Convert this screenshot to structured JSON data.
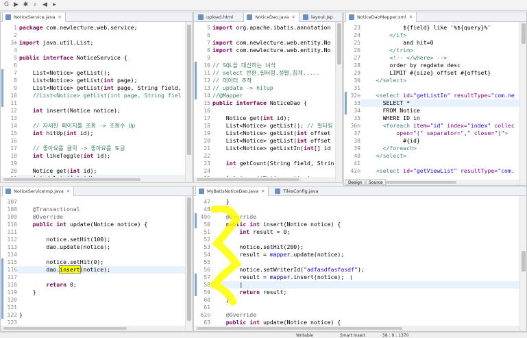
{
  "toolbar": {
    "icons": [
      "g-icon",
      "run-icon",
      "debug-icon",
      "search-icon",
      "nav-back-icon",
      "nav-forward-icon"
    ]
  },
  "pane_service": {
    "tabs": [
      {
        "label": "NoticeService.java",
        "close": "✕"
      }
    ],
    "lines": [
      {
        "n": "1",
        "t": [
          [
            "kw",
            "package "
          ],
          [
            "",
            "com.newlecture.web.service;"
          ]
        ]
      },
      {
        "n": "2",
        "t": []
      },
      {
        "n": "3⊕",
        "t": [
          [
            "kw",
            "import "
          ],
          [
            "",
            "java.util.List;"
          ]
        ]
      },
      {
        "n": "4",
        "t": []
      },
      {
        "n": "5",
        "t": [
          [
            "kw",
            "public interface "
          ],
          [
            "",
            "NoticeService {"
          ]
        ]
      },
      {
        "n": "6",
        "t": []
      },
      {
        "n": "7",
        "t": [
          [
            "",
            "    List<Notice> getList();"
          ]
        ]
      },
      {
        "n": "8",
        "t": [
          [
            "",
            "    List<Notice> getList("
          ],
          [
            "kw",
            "int "
          ],
          [
            "",
            "page);"
          ]
        ]
      },
      {
        "n": "9",
        "t": [
          [
            "",
            "    List<Notice> getList("
          ],
          [
            "kw",
            "int "
          ],
          [
            "",
            "page, String field,"
          ]
        ]
      },
      {
        "n": "10",
        "t": [
          [
            "cm",
            "    //List<Notice> getList(int page, String fiel"
          ]
        ]
      },
      {
        "n": "11",
        "t": []
      },
      {
        "n": "12",
        "t": [
          [
            "kw",
            "    int "
          ],
          [
            "",
            "insert(Notice notice);"
          ]
        ]
      },
      {
        "n": "13",
        "t": []
      },
      {
        "n": "14",
        "t": [
          [
            "cm",
            "    // 자세한 페이지를 조회 -> 조회수 Up"
          ]
        ]
      },
      {
        "n": "15",
        "t": [
          [
            "kw",
            "    int "
          ],
          [
            "",
            "hitUp("
          ],
          [
            "kw",
            "int "
          ],
          [
            "",
            "id);"
          ]
        ]
      },
      {
        "n": "16",
        "t": []
      },
      {
        "n": "17",
        "t": [
          [
            "cm",
            "    // 좋아요를 클릭 -> 좋아요를 토글"
          ]
        ]
      },
      {
        "n": "18",
        "t": [
          [
            "kw",
            "    int "
          ],
          [
            "",
            "likeToggle("
          ],
          [
            "kw",
            "int "
          ],
          [
            "",
            "id);"
          ]
        ]
      },
      {
        "n": "19",
        "t": []
      },
      {
        "n": "20",
        "t": [
          [
            "",
            "    Notice get("
          ],
          [
            "kw",
            "int "
          ],
          [
            "",
            "id);"
          ]
        ]
      },
      {
        "n": "21",
        "t": [
          [
            "kw",
            "    int "
          ],
          [
            "",
            "delete("
          ],
          [
            "kw",
            "int "
          ],
          [
            "",
            "id);"
          ]
        ]
      }
    ]
  },
  "pane_dao": {
    "tabs": [
      {
        "label": "upload.html",
        "close": ""
      },
      {
        "label": "NoticeDao.java",
        "close": "✕"
      },
      {
        "label": "layout.jsp",
        "close": ""
      }
    ],
    "lines": [
      {
        "n": "5",
        "t": [
          [
            "kw",
            "import "
          ],
          [
            "",
            "org.apache.ibatis.annotation"
          ]
        ]
      },
      {
        "n": "6",
        "t": []
      },
      {
        "n": "7",
        "t": [
          [
            "kw",
            "import "
          ],
          [
            "",
            "com.newlecture.web.entity.No"
          ]
        ]
      },
      {
        "n": "8",
        "t": [
          [
            "kw",
            "import "
          ],
          [
            "",
            "com.newlecture.web.entity.No"
          ]
        ]
      },
      {
        "n": "9",
        "t": []
      },
      {
        "n": "10",
        "t": [
          [
            "cm",
            "// SQL을 대신하는 녀석"
          ]
        ]
      },
      {
        "n": "11",
        "t": [
          [
            "cm",
            "// select 반환,필터링,정렬,집계,...."
          ]
        ]
      },
      {
        "n": "12",
        "t": [
          [
            "cm",
            "// 데이터 조작"
          ]
        ]
      },
      {
        "n": "13",
        "t": [
          [
            "cm",
            "// update -> hitup"
          ]
        ]
      },
      {
        "n": "14",
        "t": [
          [
            "cm",
            "//@Mapper"
          ]
        ]
      },
      {
        "n": "15",
        "t": [
          [
            "kw",
            "public interface "
          ],
          [
            "",
            "NoticeDao {"
          ]
        ]
      },
      {
        "n": "16",
        "t": []
      },
      {
        "n": "17",
        "t": [
          [
            "",
            "    Notice get("
          ],
          [
            "kw",
            "int "
          ],
          [
            "",
            "id);"
          ]
        ]
      },
      {
        "n": "18",
        "t": [
          [
            "",
            "    List<Notice> getList(); "
          ],
          [
            "cm",
            "// 필터링"
          ]
        ]
      },
      {
        "n": "19",
        "t": [
          [
            "",
            "    List<Notice> getList("
          ],
          [
            "kw",
            "int "
          ],
          [
            "",
            "offset"
          ]
        ]
      },
      {
        "n": "20",
        "t": [
          [
            "",
            "    List<Notice> getList("
          ],
          [
            "kw",
            "int "
          ],
          [
            "",
            "offset"
          ]
        ]
      },
      {
        "n": "21",
        "t": [
          [
            "",
            "    List<Notice> getListIn("
          ],
          [
            "kw",
            "int"
          ],
          [
            "",
            "[] id"
          ]
        ]
      },
      {
        "n": "22",
        "t": []
      },
      {
        "n": "23",
        "t": [
          [
            "kw",
            "    int "
          ],
          [
            "",
            "getCount(String field, Strin"
          ]
        ]
      },
      {
        "n": "24",
        "t": []
      },
      {
        "n": "25",
        "t": [
          [
            "kw",
            "    int "
          ],
          [
            "",
            "insert(Notice notice);"
          ]
        ]
      }
    ]
  },
  "pane_xml": {
    "tabs": [
      {
        "label": "NoticeDaoMapper.xml",
        "close": "✕"
      }
    ],
    "bottom_tabs": [
      "Design",
      "Source"
    ],
    "lines": [
      {
        "n": "23",
        "t": [
          [
            "",
            "            ${field} like '%${query}%'"
          ]
        ]
      },
      {
        "n": "24",
        "t": [
          [
            "tag",
            "        </if>"
          ]
        ]
      },
      {
        "n": "25",
        "t": [
          [
            "",
            "            and hit=0"
          ]
        ]
      },
      {
        "n": "26",
        "t": [
          [
            "tag",
            "        </trim>"
          ]
        ]
      },
      {
        "n": "27",
        "t": [
          [
            "cm",
            "        <!-- </where> -->"
          ]
        ]
      },
      {
        "n": "28",
        "t": [
          [
            "",
            "        order by regdate desc"
          ]
        ]
      },
      {
        "n": "29",
        "t": [
          [
            "",
            "        LIMIT #{size} offset #{offset}"
          ]
        ]
      },
      {
        "n": "30",
        "t": [
          [
            "tag",
            "    </select>"
          ]
        ]
      },
      {
        "n": "31",
        "t": []
      },
      {
        "n": "32⊖",
        "t": [
          [
            "tag",
            "    <select "
          ],
          [
            "attr",
            "id="
          ],
          [
            "str",
            "\"getListIn\" "
          ],
          [
            "attr",
            "resultType="
          ],
          [
            "str",
            "\"com.ne"
          ]
        ]
      },
      {
        "n": "33",
        "t": [
          [
            "",
            "      SELECT *"
          ]
        ]
      },
      {
        "n": "34",
        "t": [
          [
            "",
            "      FROM Notice"
          ]
        ]
      },
      {
        "n": "35",
        "t": [
          [
            "",
            "      WHERE ID in"
          ]
        ]
      },
      {
        "n": "36⊖",
        "t": [
          [
            "tag",
            "      <foreach "
          ],
          [
            "attr",
            "item="
          ],
          [
            "str",
            "\"id\" "
          ],
          [
            "attr",
            "index="
          ],
          [
            "str",
            "\"index\" "
          ],
          [
            "attr",
            "collec"
          ]
        ]
      },
      {
        "n": "37",
        "t": [
          [
            "attr",
            "          open="
          ],
          [
            "str",
            "\"(\" "
          ],
          [
            "attr",
            "separator="
          ],
          [
            "str",
            "\",\" "
          ],
          [
            "attr",
            "close="
          ],
          [
            "str",
            "\")\""
          ],
          [
            "tag",
            ">"
          ]
        ]
      },
      {
        "n": "38",
        "t": [
          [
            "",
            "            #{id}"
          ]
        ]
      },
      {
        "n": "39",
        "t": [
          [
            "tag",
            "      </foreach>"
          ]
        ]
      },
      {
        "n": "40",
        "t": [
          [
            "tag",
            "    </select>"
          ]
        ]
      },
      {
        "n": "41",
        "t": []
      },
      {
        "n": "42⊖",
        "t": [
          [
            "tag",
            "    <select "
          ],
          [
            "attr",
            "id="
          ],
          [
            "str",
            "\"getViewList\" "
          ],
          [
            "attr",
            "resultType="
          ],
          [
            "str",
            "\"com."
          ]
        ]
      }
    ]
  },
  "pane_impl": {
    "tabs": [
      {
        "label": "NoticeServiceImp.java",
        "close": "✕"
      }
    ],
    "lines": [
      {
        "n": "107",
        "t": []
      },
      {
        "n": "108",
        "t": [
          [
            "ann",
            "    @Transactional"
          ]
        ]
      },
      {
        "n": "109",
        "t": [
          [
            "ann",
            "    @Override"
          ]
        ]
      },
      {
        "n": "110",
        "t": [
          [
            "kw",
            "    public int "
          ],
          [
            "",
            "update(Notice notice) {"
          ]
        ]
      },
      {
        "n": "111",
        "t": []
      },
      {
        "n": "112",
        "t": [
          [
            "",
            "        notice.setHit(100);"
          ]
        ]
      },
      {
        "n": "113",
        "t": [
          [
            "",
            "        dao.update(notice);"
          ]
        ]
      },
      {
        "n": "114",
        "t": []
      },
      {
        "n": "115",
        "t": [
          [
            "",
            "        notice.setHit(0);"
          ]
        ]
      },
      {
        "n": "116",
        "t": [
          [
            "",
            "        dao."
          ],
          [
            "hl",
            "insert"
          ],
          [
            "",
            "(notice);"
          ]
        ]
      },
      {
        "n": "117",
        "t": []
      },
      {
        "n": "118",
        "t": [
          [
            "kw",
            "        return "
          ],
          [
            "",
            "0;"
          ]
        ]
      },
      {
        "n": "119",
        "t": [
          [
            "",
            "    }"
          ]
        ]
      },
      {
        "n": "120",
        "t": []
      },
      {
        "n": "121",
        "t": []
      },
      {
        "n": "122",
        "t": [
          [
            "",
            "}"
          ]
        ]
      },
      {
        "n": "123",
        "t": []
      }
    ]
  },
  "pane_mybatis": {
    "tabs": [
      {
        "label": "MyBatisNoticeDao.java",
        "close": "✕"
      },
      {
        "label": "TilesConfig.java",
        "close": ""
      }
    ],
    "lines": [
      {
        "n": "47",
        "t": [
          [
            "",
            "    }"
          ]
        ]
      },
      {
        "n": "48",
        "t": []
      },
      {
        "n": "49⊖",
        "t": [
          [
            "ann",
            "    @Override"
          ]
        ]
      },
      {
        "n": "50",
        "t": [
          [
            "kw",
            "    public int "
          ],
          [
            "",
            "insert(Notice notice) {"
          ]
        ]
      },
      {
        "n": "51",
        "t": [
          [
            "kw",
            "        int "
          ],
          [
            "",
            "result = 0;"
          ]
        ]
      },
      {
        "n": "52",
        "t": []
      },
      {
        "n": "53",
        "t": [
          [
            "",
            "        notice.setHit(200);"
          ]
        ]
      },
      {
        "n": "54",
        "t": [
          [
            "",
            "        result = "
          ],
          [
            "fld",
            "mapper"
          ],
          [
            "",
            ".update(notice);"
          ]
        ]
      },
      {
        "n": "55",
        "t": []
      },
      {
        "n": "56",
        "t": [
          [
            "",
            "        notice.setWriterId("
          ],
          [
            "str",
            "\"adfasdfasfasdf\""
          ],
          [
            "",
            ");"
          ]
        ]
      },
      {
        "n": "57",
        "t": [
          [
            "",
            "        result = "
          ],
          [
            "fld",
            "mapper"
          ],
          [
            "",
            ".insert(notice);"
          ]
        ]
      },
      {
        "n": "58",
        "t": [
          [
            "",
            "        |"
          ]
        ]
      },
      {
        "n": "59",
        "t": [
          [
            "kw",
            "        return "
          ],
          [
            "",
            "result;"
          ]
        ]
      },
      {
        "n": "60",
        "t": [
          [
            "",
            "    }"
          ]
        ]
      },
      {
        "n": "61",
        "t": []
      },
      {
        "n": "62⊖",
        "t": [
          [
            "ann",
            "    @Override"
          ]
        ]
      },
      {
        "n": "63",
        "t": [
          [
            "kw",
            "    public int "
          ],
          [
            "",
            "update(Notice notice) {"
          ]
        ]
      }
    ]
  },
  "status": {
    "writable": "Writable",
    "insert_mode": "Smart Insert",
    "position": "58 : 9 : 1370"
  },
  "colors": {
    "highlight_yellow": "#ffff00",
    "keyword": "#7f0055",
    "comment": "#3f7f5f",
    "string": "#2a00ff"
  }
}
